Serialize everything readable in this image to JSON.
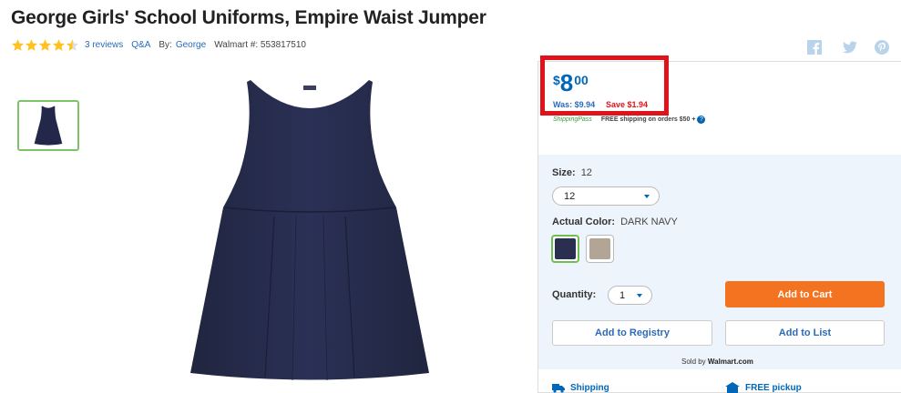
{
  "product": {
    "title": "George Girls' School Uniforms, Empire Waist Jumper",
    "rating": 4.5,
    "reviews_label": "3 reviews",
    "qa_label": "Q&A",
    "by_prefix": "By:",
    "brand": "George",
    "walmart_number": "Walmart #: 553817510"
  },
  "social": [
    "facebook-icon",
    "twitter-icon",
    "pinterest-icon"
  ],
  "price": {
    "currency": "$",
    "dollars": "8",
    "cents": "00",
    "was": "Was: $9.94",
    "save": "Save $1.94",
    "shipping_pass": "ShippingPass",
    "free_shipping": "FREE shipping on orders $50 +"
  },
  "options": {
    "size_label": "Size:",
    "size_value": "12",
    "size_selected": "12",
    "color_label": "Actual Color:",
    "color_value": "DARK NAVY",
    "swatches": [
      {
        "name": "dark-navy",
        "color": "#2b2f4f",
        "selected": true
      },
      {
        "name": "khaki",
        "color": "#b3a595",
        "selected": false
      }
    ],
    "quantity_label": "Quantity:",
    "quantity_value": "1"
  },
  "actions": {
    "add_to_cart": "Add to Cart",
    "add_to_registry": "Add to Registry",
    "add_to_list": "Add to List",
    "sold_by_prefix": "Sold by",
    "sold_by": "Walmart.com"
  },
  "fulfillment": {
    "shipping": "Shipping",
    "pickup": "FREE pickup"
  },
  "colors": {
    "brand_blue": "#0067b8",
    "cart_orange": "#f47321",
    "sale_red": "#e1131a",
    "star_gold": "#ffc220"
  }
}
